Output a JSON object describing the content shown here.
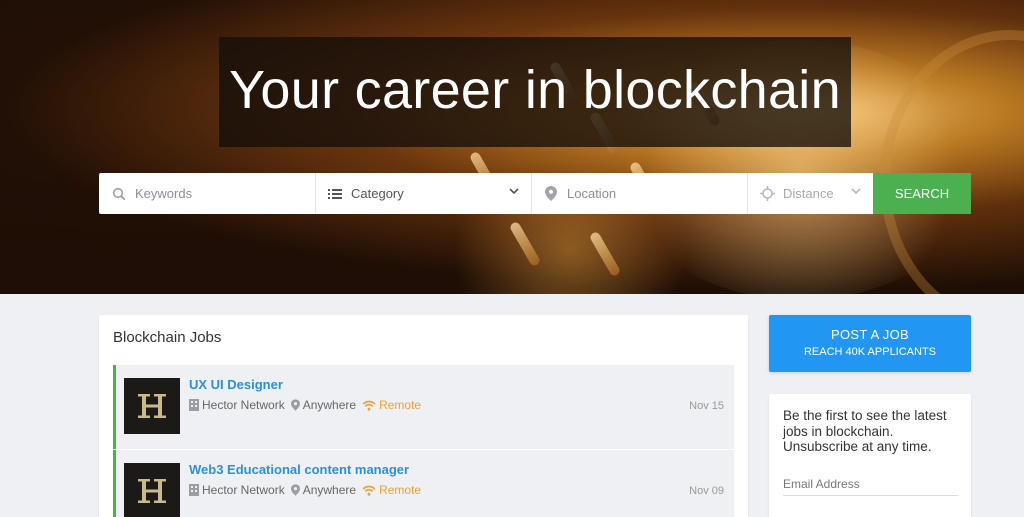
{
  "hero": {
    "title": "Your career in blockchain"
  },
  "search": {
    "keywords_placeholder": "Keywords",
    "category_label": "Category",
    "location_placeholder": "Location",
    "distance_label": "Distance",
    "search_button": "SEARCH"
  },
  "jobs": {
    "title": "Blockchain Jobs",
    "items": [
      {
        "title": "UX UI Designer",
        "company": "Hector Network",
        "location": "Anywhere",
        "type": "Remote",
        "date": "Nov 15"
      },
      {
        "title": "Web3 Educational content manager",
        "company": "Hector Network",
        "location": "Anywhere",
        "type": "Remote",
        "date": "Nov 09"
      }
    ]
  },
  "sidebar": {
    "post_job_label": "POST A JOB",
    "post_job_sub": "REACH 40K APPLICANTS",
    "newsletter_text": "Be the first to see the latest jobs in blockchain. Unsubscribe at any time.",
    "email_placeholder": "Email Address"
  },
  "colors": {
    "accent_green": "#4caf50",
    "accent_blue": "#2196f3",
    "link_blue": "#2b8fdb",
    "remote_orange": "#f0a030"
  }
}
